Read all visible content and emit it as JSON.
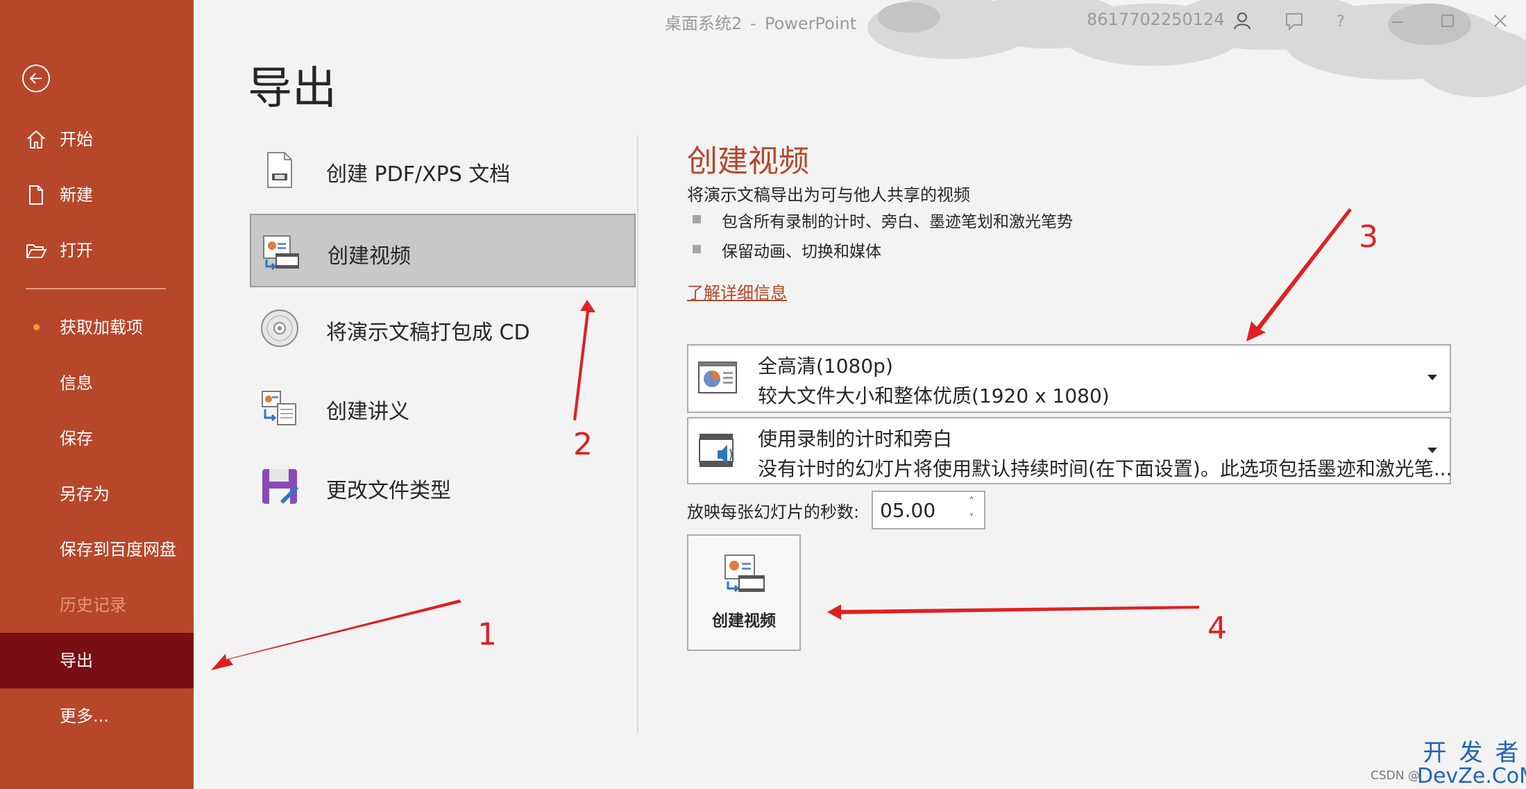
{
  "app": {
    "document_name": "桌面系统2",
    "separator": "-",
    "app_name": "PowerPoint",
    "account_id": "8617702250124"
  },
  "sidebar": {
    "items": [
      {
        "label": "开始",
        "icon": "home-icon"
      },
      {
        "label": "新建",
        "icon": "new-document-icon"
      },
      {
        "label": "打开",
        "icon": "open-folder-icon"
      },
      {
        "label": "获取加载项"
      },
      {
        "label": "信息"
      },
      {
        "label": "保存"
      },
      {
        "label": "另存为"
      },
      {
        "label": "保存到百度网盘"
      },
      {
        "label": "历史记录",
        "state": "disabled"
      },
      {
        "label": "导出",
        "state": "selected"
      },
      {
        "label": "更多..."
      }
    ]
  },
  "main": {
    "heading": "导出",
    "options": [
      {
        "label": "创建 PDF/XPS 文档",
        "icon": "pdf-document-icon"
      },
      {
        "label": "创建视频",
        "icon": "create-video-icon",
        "selected": true
      },
      {
        "label": "将演示文稿打包成 CD",
        "icon": "cd-icon"
      },
      {
        "label": "创建讲义",
        "icon": "handout-icon"
      },
      {
        "label": "更改文件类型",
        "icon": "save-as-type-icon"
      }
    ]
  },
  "detail": {
    "title": "创建视频",
    "description": "将演示文稿导出为可与他人共享的视频",
    "bullets": [
      "包含所有录制的计时、旁白、墨迹笔划和激光笔势",
      "保留动画、切换和媒体"
    ],
    "learn_more": "了解详细信息",
    "quality": {
      "main": "全高清(1080p)",
      "sub": "较大文件大小和整体优质(1920 x 1080)"
    },
    "timing": {
      "main": "使用录制的计时和旁白",
      "sub": "没有计时的幻灯片将使用默认持续时间(在下面设置)。此选项包括墨迹和激光笔..."
    },
    "seconds_label": "放映每张幻灯片的秒数:",
    "seconds_value": "05.00",
    "create_button": "创建视频"
  },
  "annotations": [
    "1",
    "2",
    "3",
    "4"
  ],
  "watermark": {
    "csdn": "CSDN @",
    "top": "开发者",
    "bottom": "DevZe.CoM"
  },
  "colors": {
    "sidebar": "#b7472a",
    "sidebar_selected": "#7a0e15",
    "accent": "#b7472a",
    "annotation": "#e02020"
  }
}
